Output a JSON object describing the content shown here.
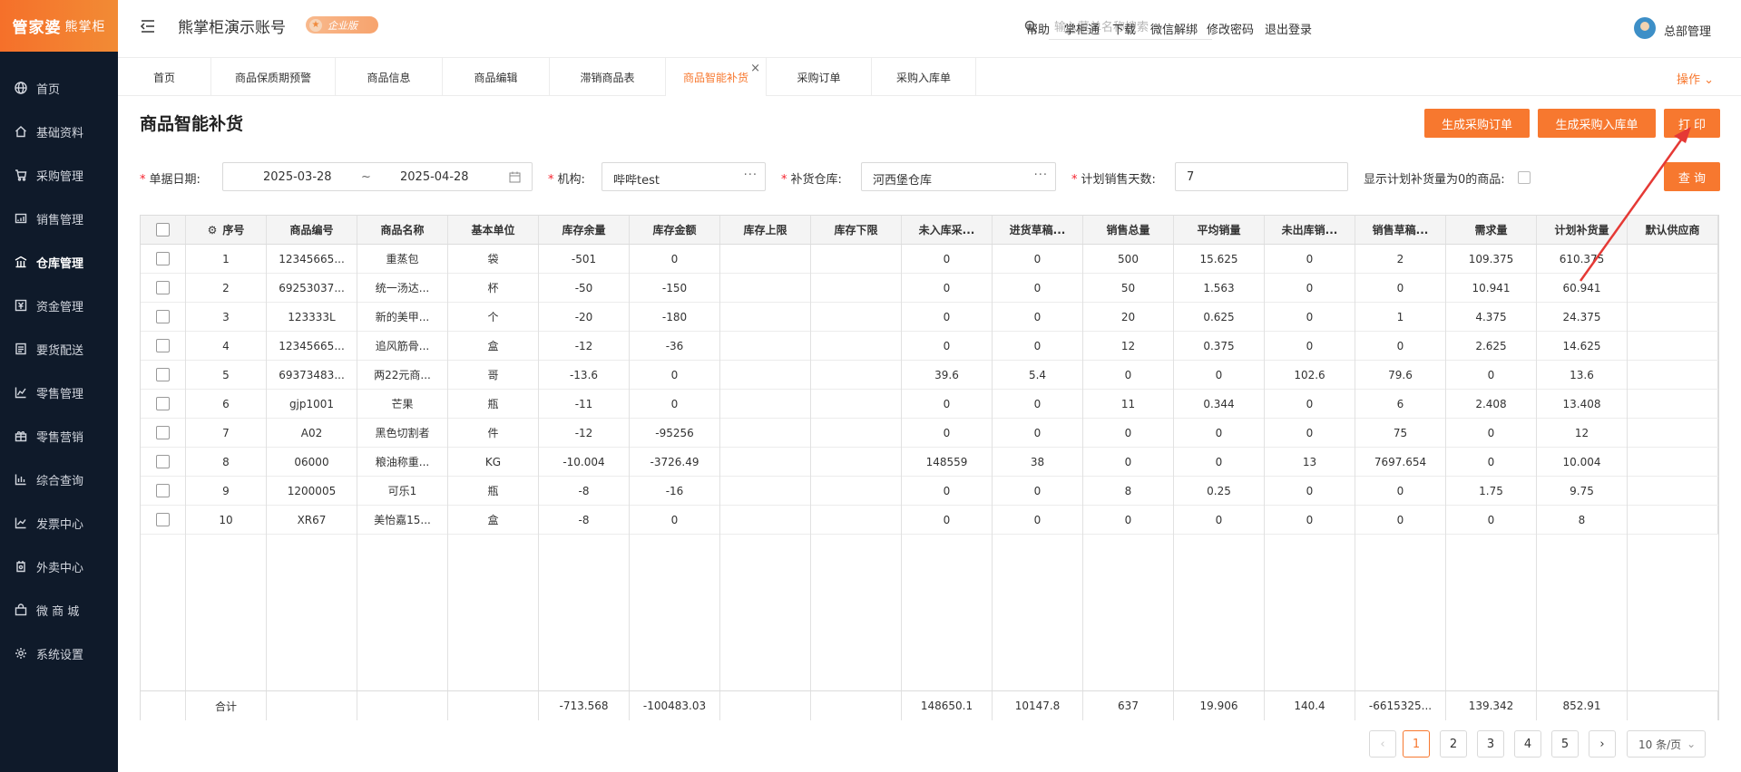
{
  "logo": {
    "text": "管家婆",
    "sub": "熊掌柜"
  },
  "sidebar": {
    "items": [
      {
        "label": "首页",
        "icon": "globe-icon"
      },
      {
        "label": "基础资料",
        "icon": "home-icon"
      },
      {
        "label": "采购管理",
        "icon": "cart-icon"
      },
      {
        "label": "销售管理",
        "icon": "sales-icon"
      },
      {
        "label": "仓库管理",
        "icon": "warehouse-icon"
      },
      {
        "label": "资金管理",
        "icon": "money-icon"
      },
      {
        "label": "要货配送",
        "icon": "list-icon"
      },
      {
        "label": "零售管理",
        "icon": "chart-icon"
      },
      {
        "label": "零售营销",
        "icon": "gift-icon"
      },
      {
        "label": "综合查询",
        "icon": "bar-icon"
      },
      {
        "label": "发票中心",
        "icon": "invoice-icon"
      },
      {
        "label": "外卖中心",
        "icon": "delivery-icon"
      },
      {
        "label": "微 商 城",
        "icon": "shop-icon"
      },
      {
        "label": "系统设置",
        "icon": "gear-icon"
      }
    ],
    "active_index": 4
  },
  "header": {
    "account": "熊掌柜演示账号",
    "badge": "企业版",
    "search_placeholder": "输入菜单名称搜索",
    "links": [
      "帮助",
      "掌柜通",
      "下载",
      "微信解绑",
      "修改密码",
      "退出登录"
    ],
    "user": "总部管理"
  },
  "tabs": [
    {
      "label": "首页"
    },
    {
      "label": "商品保质期预警"
    },
    {
      "label": "商品信息"
    },
    {
      "label": "商品编辑"
    },
    {
      "label": "滞销商品表"
    },
    {
      "label": "商品智能补货"
    },
    {
      "label": "采购订单"
    },
    {
      "label": "采购入库单"
    }
  ],
  "active_tab": 5,
  "ops_label": "操作",
  "page": {
    "title": "商品智能补货",
    "btn_po": "生成采购订单",
    "btn_pi": "生成采购入库单",
    "btn_print": "打 印",
    "btn_query": "查 询"
  },
  "filters": {
    "date_label": "单据日期:",
    "date_from": "2025-03-28",
    "date_sep": "~",
    "date_to": "2025-04-28",
    "org_label": "机构:",
    "org_value": "哔哔test",
    "wh_label": "补货仓库:",
    "wh_value": "河西堡仓库",
    "days_label": "计划销售天数:",
    "days_value": "7",
    "zero_label": "显示计划补货量为0的商品:"
  },
  "table": {
    "columns": [
      "序号",
      "商品编号",
      "商品名称",
      "基本单位",
      "库存余量",
      "库存金额",
      "库存上限",
      "库存下限",
      "未入库采...",
      "进货草稿...",
      "销售总量",
      "平均销量",
      "未出库销...",
      "销售草稿...",
      "需求量",
      "计划补货量",
      "默认供应商"
    ],
    "rows": [
      [
        "1",
        "12345665...",
        "重蒸包",
        "袋",
        "-501",
        "0",
        "",
        "",
        "0",
        "0",
        "500",
        "15.625",
        "0",
        "2",
        "109.375",
        "610.375",
        ""
      ],
      [
        "2",
        "69253037...",
        "统一汤达...",
        "杯",
        "-50",
        "-150",
        "",
        "",
        "0",
        "0",
        "50",
        "1.563",
        "0",
        "0",
        "10.941",
        "60.941",
        ""
      ],
      [
        "3",
        "123333L",
        "新的美甲...",
        "个",
        "-20",
        "-180",
        "",
        "",
        "0",
        "0",
        "20",
        "0.625",
        "0",
        "1",
        "4.375",
        "24.375",
        ""
      ],
      [
        "4",
        "12345665...",
        "追风筋骨...",
        "盒",
        "-12",
        "-36",
        "",
        "",
        "0",
        "0",
        "12",
        "0.375",
        "0",
        "0",
        "2.625",
        "14.625",
        ""
      ],
      [
        "5",
        "69373483...",
        "两22元商...",
        "哥",
        "-13.6",
        "0",
        "",
        "",
        "39.6",
        "5.4",
        "0",
        "0",
        "102.6",
        "79.6",
        "0",
        "13.6",
        ""
      ],
      [
        "6",
        "gjp1001",
        "芒果",
        "瓶",
        "-11",
        "0",
        "",
        "",
        "0",
        "0",
        "11",
        "0.344",
        "0",
        "6",
        "2.408",
        "13.408",
        ""
      ],
      [
        "7",
        "A02",
        "黑色切割者",
        "件",
        "-12",
        "-95256",
        "",
        "",
        "0",
        "0",
        "0",
        "0",
        "0",
        "75",
        "0",
        "12",
        ""
      ],
      [
        "8",
        "06000",
        "粮油称重...",
        "KG",
        "-10.004",
        "-3726.49",
        "",
        "",
        "148559",
        "38",
        "0",
        "0",
        "13",
        "7697.654",
        "0",
        "10.004",
        ""
      ],
      [
        "9",
        "1200005",
        "可乐1",
        "瓶",
        "-8",
        "-16",
        "",
        "",
        "0",
        "0",
        "8",
        "0.25",
        "0",
        "0",
        "1.75",
        "9.75",
        ""
      ],
      [
        "10",
        "XR67",
        "美怡嘉15...",
        "盒",
        "-8",
        "0",
        "",
        "",
        "0",
        "0",
        "0",
        "0",
        "0",
        "0",
        "0",
        "8",
        ""
      ]
    ],
    "footer": [
      "合计",
      "",
      "",
      "",
      "-713.568",
      "-100483.03",
      "",
      "",
      "148650.1",
      "10147.8",
      "637",
      "19.906",
      "140.4",
      "-6615325...",
      "139.342",
      "852.91",
      ""
    ]
  },
  "pagination": {
    "pages": [
      "1",
      "2",
      "3",
      "4",
      "5"
    ],
    "current": "1",
    "prev": "‹",
    "next": "›",
    "page_size": "10 条/页"
  },
  "colors": {
    "accent": "#f7782f",
    "sidebar": "#0f1a2a",
    "annotation": "#e53935"
  }
}
